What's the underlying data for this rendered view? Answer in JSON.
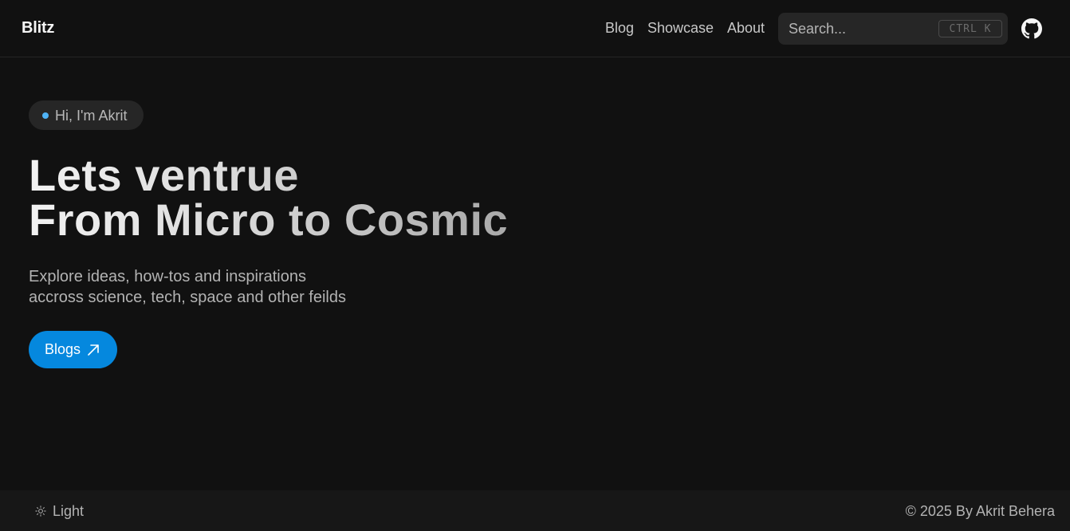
{
  "header": {
    "brand": "Blitz",
    "nav": [
      {
        "label": "Blog"
      },
      {
        "label": "Showcase"
      },
      {
        "label": "About"
      }
    ],
    "search": {
      "placeholder": "Search...",
      "shortcut": "CTRL K"
    },
    "github_icon": "github-icon"
  },
  "hero": {
    "badge": "Hi, I'm Akrit",
    "headline": [
      "Lets ventrue",
      "From Micro to Cosmic"
    ],
    "subtitle": [
      "Explore ideas, how-tos and inspirations",
      "accross science, tech, space and other feilds"
    ],
    "cta": {
      "label": "Blogs",
      "icon": "arrow-up-right-icon"
    }
  },
  "footer": {
    "theme_toggle": {
      "label": "Light",
      "icon": "sun-icon"
    },
    "copyright": "© 2025 By Akrit Behera"
  },
  "colors": {
    "background": "#111111",
    "accent": "#0588de",
    "badge_dot": "#4fb3f6"
  }
}
